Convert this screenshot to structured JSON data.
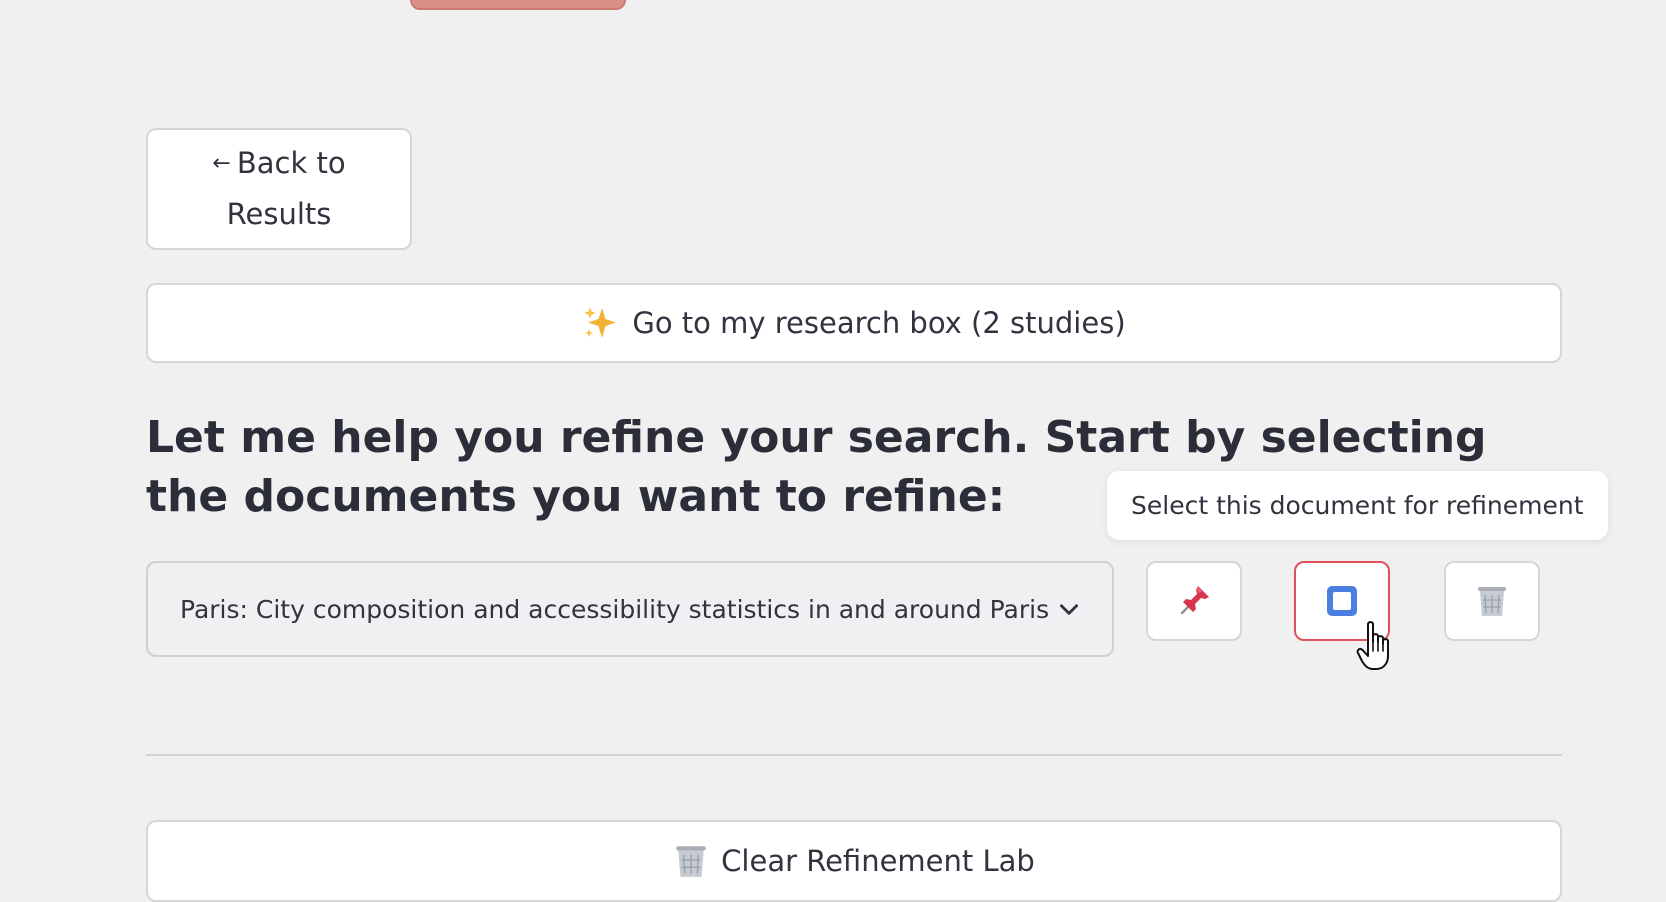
{
  "nav": {
    "back_line1": "Back to",
    "back_line2": "Results"
  },
  "research_box": {
    "label": "Go to my research box (2 studies)",
    "icon": "sparkles-icon"
  },
  "refine": {
    "heading": "Let me help you refine your search. Start by selecting the documents you want to refine:",
    "selected_document": "Paris: City composition and accessibility statistics in and around Paris",
    "tooltip": "Select this document for refinement",
    "actions": [
      {
        "name": "pin-button",
        "icon": "pushpin-icon"
      },
      {
        "name": "select-document-button",
        "icon": "checkbox-square-icon"
      },
      {
        "name": "delete-button",
        "icon": "wastebasket-icon"
      }
    ]
  },
  "clear": {
    "label": "Clear Refinement Lab",
    "icon": "wastebasket-icon"
  },
  "colors": {
    "background": "#f0f0f0",
    "active_border": "#e0525a",
    "text": "#31333f"
  }
}
